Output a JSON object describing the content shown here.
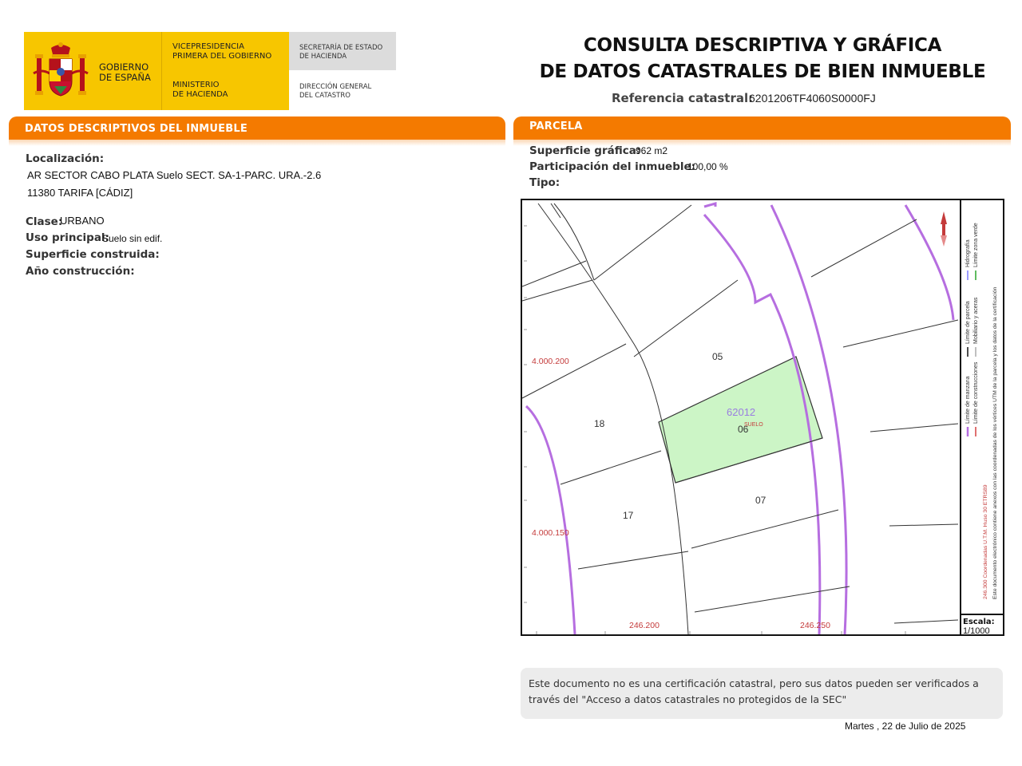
{
  "header": {
    "gobierno": "GOBIERNO\nDE ESPAÑA",
    "vicepresidencia": "VICEPRESIDENCIA\nPRIMERA DEL GOBIERNO",
    "ministerio": "MINISTERIO\nDE HACIENDA",
    "secretaria": "SECRETARÍA DE ESTADO\nDE HACIENDA",
    "direccion": "DIRECCIÓN GENERAL\nDEL CATASTRO",
    "title_line1": "CONSULTA DESCRIPTIVA Y GRÁFICA",
    "title_line2": "DE DATOS CATASTRALES DE BIEN INMUEBLE",
    "ref_label": "Referencia catastral:",
    "ref_value": "6201206TF4060S0000FJ"
  },
  "descriptive": {
    "banner": "DATOS DESCRIPTIVOS DEL INMUEBLE",
    "localizacion_label": "Localización:",
    "localizacion_line1": "AR SECTOR CABO PLATA  Suelo SECT. SA-1-PARC. URA.-2.6",
    "localizacion_line2": "11380 TARIFA [CÁDIZ]",
    "clase_label": "Clase:",
    "clase_value": "URBANO",
    "uso_label": "Uso principal:",
    "uso_value": "Suelo sin edif.",
    "superficie_label": "Superficie construida:",
    "anio_label": "Año construcción:"
  },
  "parcela": {
    "banner": "PARCELA",
    "superficie_label": "Superficie gráfica:",
    "superficie_value": "962 m2",
    "participacion_label": "Participación del inmueble:",
    "participacion_value": "100,00 %",
    "tipo_label": "Tipo:"
  },
  "map": {
    "parcel_labels": [
      "05",
      "06",
      "07",
      "17",
      "18"
    ],
    "block_number": "62012",
    "suelo_label": "SUELO",
    "y_coords": [
      "4.000.200",
      "4.000.150"
    ],
    "x_coords": [
      "246.200",
      "246.250"
    ],
    "legend_col1": [
      {
        "text": "Límite de manzana",
        "color": "#b66ee0"
      },
      {
        "text": "Límite de parcela",
        "color": "#111111"
      },
      {
        "text": "Hidrografía",
        "color": "#7a7aff"
      }
    ],
    "legend_col2": [
      {
        "text": "Límite de construcciones",
        "color": "#d44040"
      },
      {
        "text": "Mobiliario y aceras",
        "color": "#aaaaaa"
      },
      {
        "text": "Límite zona verde",
        "color": "#2aa52a"
      }
    ],
    "coords_text": "246.300 Coordenadas U.T.M. Huso 30 ETRS89",
    "electronic_text": "Este documento electrónico contiene anexos con las coordenadas de los vértices UTM de la parcela y los datos de la certificación",
    "escala_label": "Escala:",
    "escala_value": "1/1000",
    "colors": {
      "parcel_fill": "#ccf5c6",
      "block_line": "#b66ee0",
      "coord_text": "#c43a3a",
      "block_text": "#9a7ee0"
    }
  },
  "footer": {
    "note": "Este documento no es una certificación catastral, pero sus datos pueden ser verificados a través del \"Acceso a datos catastrales no protegidos de la SEC\"",
    "date": "Martes , 22 de Julio de 2025"
  }
}
